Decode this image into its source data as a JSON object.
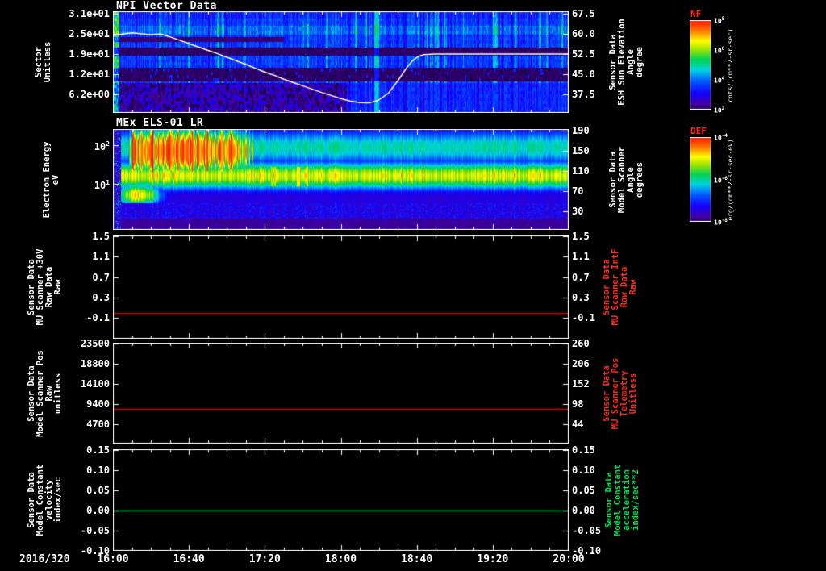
{
  "figure": {
    "background": "#000000",
    "date_label": "2016/320",
    "x_axis": {
      "tick_labels": [
        "16:00",
        "16:40",
        "17:20",
        "18:00",
        "18:40",
        "19:20",
        "20:00"
      ],
      "range_hours": [
        16.0,
        20.0
      ],
      "minor_tick_minutes": 10,
      "major_tick_minutes": 40
    }
  },
  "colorbars": [
    {
      "id": "nf",
      "label": "NF",
      "label_color": "#ff2a1a",
      "units": "cnts/(cm**2-sr-sec)",
      "tick_exponents": [
        "8",
        "6",
        "4",
        "2"
      ],
      "tick_fracs": [
        0,
        0.333,
        0.667,
        1
      ]
    },
    {
      "id": "def",
      "label": "DEF",
      "label_color": "#ff2a1a",
      "units": "erg/(cm**2-sr-sec-eV)",
      "tick_exponents": [
        "-4",
        "-6",
        "-8"
      ],
      "tick_fracs": [
        0,
        0.5,
        1
      ]
    }
  ],
  "chart_data": [
    {
      "id": "npi-vector",
      "type": "heatmap",
      "title": "NPI Vector Data",
      "left_axis": {
        "label_lines": [
          "Sector",
          "Unitless"
        ],
        "ticks": [
          {
            "label": "3.1e+01",
            "frac": 0.024
          },
          {
            "label": "2.5e+01",
            "frac": 0.222
          },
          {
            "label": "1.9e+01",
            "frac": 0.421
          },
          {
            "label": "1.2e+01",
            "frac": 0.619
          },
          {
            "label": "6.2e+00",
            "frac": 0.817
          }
        ]
      },
      "right_axis": {
        "label_lines": [
          "Sensor Data",
          "ESH Sun Elevation",
          "Angle",
          "degree"
        ],
        "color": "#ffffff",
        "ticks": [
          {
            "label": "67.5",
            "frac": 0.024
          },
          {
            "label": "60.0",
            "frac": 0.222
          },
          {
            "label": "52.5",
            "frac": 0.421
          },
          {
            "label": "45.0",
            "frac": 0.619
          },
          {
            "label": "37.5",
            "frac": 0.817
          }
        ],
        "vmap": {
          "v0": 67.5,
          "f0": 0.024,
          "v1": 37.5,
          "f1": 0.817
        }
      },
      "heatmap_style": "npi",
      "heatmap_notes": "32 azimuth sectors, mostly blue counts with vertical striping; black bands near sectors 10-14 and 19-21; purple speckled low sectors before 18:00; bright cyan stripe near 18:20; bright left edge column",
      "overlay_line": {
        "name": "esh-sun-elevation-angle",
        "color": "#ffffff",
        "units": "degree",
        "points": [
          [
            16.0,
            59.3
          ],
          [
            16.08,
            59.9
          ],
          [
            16.17,
            60.4
          ],
          [
            16.25,
            60.0
          ],
          [
            16.33,
            59.7
          ],
          [
            16.42,
            59.9
          ],
          [
            16.5,
            58.9
          ],
          [
            16.58,
            57.7
          ],
          [
            16.67,
            56.3
          ],
          [
            16.75,
            55.1
          ],
          [
            16.83,
            53.9
          ],
          [
            16.92,
            52.6
          ],
          [
            17.0,
            51.3
          ],
          [
            17.08,
            50.0
          ],
          [
            17.17,
            48.6
          ],
          [
            17.25,
            47.2
          ],
          [
            17.33,
            45.8
          ],
          [
            17.42,
            44.5
          ],
          [
            17.5,
            43.1
          ],
          [
            17.58,
            41.9
          ],
          [
            17.67,
            40.6
          ],
          [
            17.75,
            39.4
          ],
          [
            17.83,
            38.2
          ],
          [
            17.92,
            37.0
          ],
          [
            18.0,
            35.9
          ],
          [
            18.08,
            35.0
          ],
          [
            18.17,
            34.4
          ],
          [
            18.25,
            34.3
          ],
          [
            18.33,
            35.3
          ],
          [
            18.42,
            38.0
          ],
          [
            18.5,
            42.5
          ],
          [
            18.58,
            47.5
          ],
          [
            18.63,
            50.0
          ],
          [
            18.68,
            51.6
          ],
          [
            18.73,
            52.3
          ],
          [
            18.83,
            52.5
          ],
          [
            19.0,
            52.5
          ],
          [
            19.33,
            52.5
          ],
          [
            19.67,
            52.5
          ],
          [
            20.0,
            52.5
          ]
        ]
      }
    },
    {
      "id": "els",
      "type": "heatmap",
      "title": "MEx ELS-01 LR",
      "left_axis": {
        "label_lines": [
          "Electron Energy",
          "eV"
        ],
        "exp_ticks": [
          {
            "exp": "2",
            "frac": 0.16
          },
          {
            "exp": "1",
            "frac": 0.544
          }
        ]
      },
      "right_axis": {
        "label_lines": [
          "Sensor Data",
          "Model Scanner",
          "Angle",
          "degrees"
        ],
        "color": "#ffffff",
        "ticks": [
          {
            "label": "190",
            "frac": 0.016
          },
          {
            "label": "150",
            "frac": 0.216
          },
          {
            "label": "110",
            "frac": 0.416
          },
          {
            "label": "70",
            "frac": 0.616
          },
          {
            "label": "30",
            "frac": 0.816
          }
        ]
      },
      "heatmap_style": "els",
      "energy_range_ev": [
        0.65,
        260
      ],
      "features": {
        "hot_interval_hours": [
          16.1,
          17.35
        ],
        "band_center_ev": 17,
        "band_top_ev": 90,
        "notes": "persistent yellow band 8-60 eV, green shoulder to ~150 eV, intense red enhancement 30-250 eV from ~16:06 to ~17:15, blue speckle below ~3 eV"
      }
    },
    {
      "id": "mu-scanner-30v",
      "type": "line",
      "left_axis": {
        "label_lines": [
          "Sensor Data",
          "MU Scanner +30V",
          "Raw Data",
          "Raw"
        ],
        "ticks": [
          {
            "label": "1.5",
            "frac": 0.008
          },
          {
            "label": "1.1",
            "frac": 0.203
          },
          {
            "label": "0.7",
            "frac": 0.406
          },
          {
            "label": "0.3",
            "frac": 0.602
          },
          {
            "label": "-0.1",
            "frac": 0.797
          }
        ]
      },
      "right_axis": {
        "label_lines": [
          "Sensor Data",
          "MU Scanner IntF",
          "Raw Data",
          "Raw"
        ],
        "color": "#ff2a1a",
        "ticks": [
          {
            "label": "1.5",
            "frac": 0.008
          },
          {
            "label": "1.1",
            "frac": 0.203
          },
          {
            "label": "0.7",
            "frac": 0.406
          },
          {
            "label": "0.3",
            "frac": 0.602
          },
          {
            "label": "-0.1",
            "frac": 0.797
          }
        ]
      },
      "vmap": {
        "v0": 1.5,
        "f0": 0.008,
        "v1": -0.1,
        "f1": 0.797
      },
      "series": [
        {
          "name": "mu-scanner-intf-raw",
          "color": "#cc0000",
          "constant_value": 0.0
        }
      ]
    },
    {
      "id": "model-scanner-pos",
      "type": "line",
      "left_axis": {
        "label_lines": [
          "Sensor Data",
          "Model Scanner Pos",
          "Raw",
          "unitless"
        ],
        "ticks": [
          {
            "label": "23500",
            "frac": 0.008
          },
          {
            "label": "18800",
            "frac": 0.208
          },
          {
            "label": "14100",
            "frac": 0.408
          },
          {
            "label": "9400",
            "frac": 0.608
          },
          {
            "label": "4700",
            "frac": 0.808
          }
        ]
      },
      "right_axis": {
        "label_lines": [
          "Sensor Data",
          "MU Scanner Pos",
          "Telemetry",
          "Unitless"
        ],
        "color": "#ff2a1a",
        "ticks": [
          {
            "label": "260",
            "frac": 0.008
          },
          {
            "label": "206",
            "frac": 0.208
          },
          {
            "label": "152",
            "frac": 0.408
          },
          {
            "label": "98",
            "frac": 0.608
          },
          {
            "label": "44",
            "frac": 0.808
          }
        ]
      },
      "vmap": {
        "v0": 23500,
        "f0": 0.008,
        "v1": 4700,
        "f1": 0.808
      },
      "series": [
        {
          "name": "scanner-position",
          "color": "#cc0000",
          "constant_value": 8192
        }
      ]
    },
    {
      "id": "model-constant-velocity",
      "type": "line",
      "left_axis": {
        "label_lines": [
          "Sensor Data",
          "Model Constant",
          "velocity",
          "index/sec"
        ],
        "ticks": [
          {
            "label": "0.15",
            "frac": 0.008
          },
          {
            "label": "0.10",
            "frac": 0.206
          },
          {
            "label": "0.05",
            "frac": 0.405
          },
          {
            "label": "0.00",
            "frac": 0.603
          },
          {
            "label": "-0.05",
            "frac": 0.802
          },
          {
            "label": "-0.10",
            "frac": 1.0
          }
        ]
      },
      "right_axis": {
        "label_lines": [
          "Sensor Data",
          "Model Constant",
          "acceleration",
          "index/sec**2"
        ],
        "color": "#00dd50",
        "ticks": [
          {
            "label": "0.15",
            "frac": 0.008
          },
          {
            "label": "0.10",
            "frac": 0.206
          },
          {
            "label": "0.05",
            "frac": 0.405
          },
          {
            "label": "0.00",
            "frac": 0.603
          },
          {
            "label": "-0.05",
            "frac": 0.802
          },
          {
            "label": "-0.10",
            "frac": 1.0
          }
        ]
      },
      "vmap": {
        "v0": 0.15,
        "f0": 0.008,
        "v1": -0.1,
        "f1": 1.0
      },
      "series": [
        {
          "name": "model-constant-velocity",
          "color": "#00bb44",
          "constant_value": 0.0
        }
      ]
    }
  ]
}
